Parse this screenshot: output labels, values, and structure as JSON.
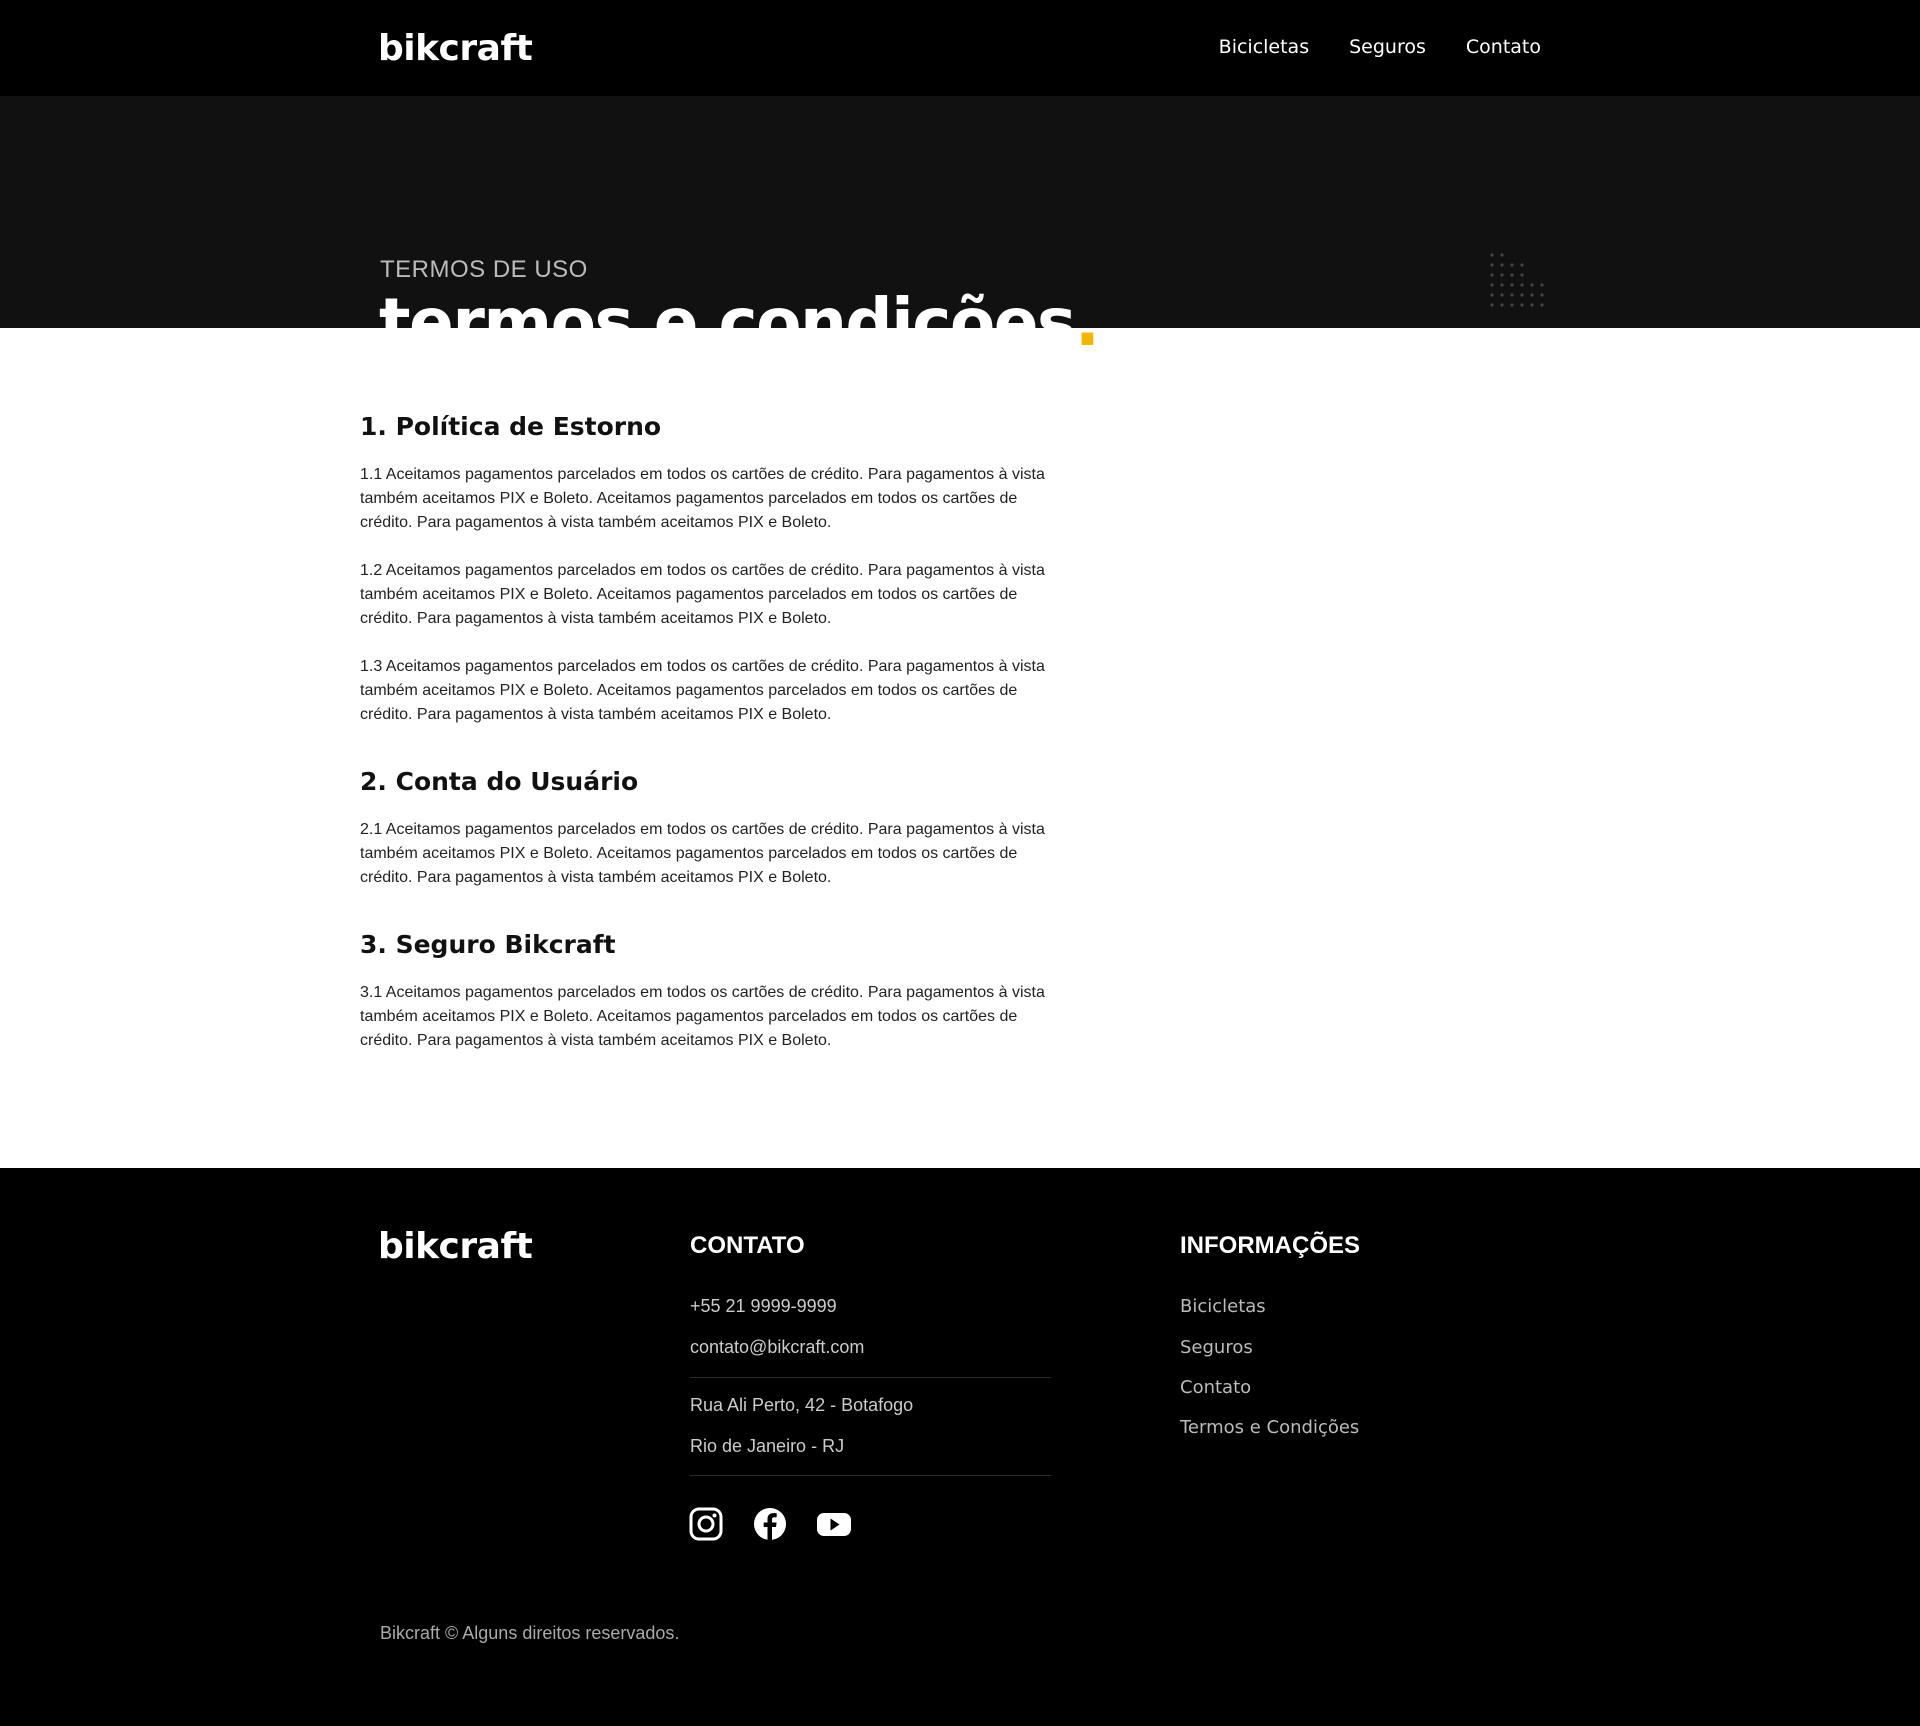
{
  "header": {
    "logo": "bikcraft",
    "nav": [
      "Bicicletas",
      "Seguros",
      "Contato"
    ]
  },
  "hero": {
    "subtitle": "TERMOS DE USO",
    "title": "termos e condições",
    "title_dot": ".",
    "accent_color": "#f2b705"
  },
  "sections": [
    {
      "title": "1. Política de Estorno",
      "paragraphs": [
        "1.1 Aceitamos pagamentos parcelados em todos os cartões de crédito. Para pagamentos à vista também aceitamos PIX e Boleto. Aceitamos pagamentos parcelados em todos os cartões de crédito. Para pagamentos à vista também aceitamos PIX e Boleto.",
        "1.2 Aceitamos pagamentos parcelados em todos os cartões de crédito. Para pagamentos à vista também aceitamos PIX e Boleto. Aceitamos pagamentos parcelados em todos os cartões de crédito. Para pagamentos à vista também aceitamos PIX e Boleto.",
        "1.3 Aceitamos pagamentos parcelados em todos os cartões de crédito. Para pagamentos à vista também aceitamos PIX e Boleto. Aceitamos pagamentos parcelados em todos os cartões de crédito. Para pagamentos à vista também aceitamos PIX e Boleto."
      ]
    },
    {
      "title": "2. Conta do Usuário",
      "paragraphs": [
        "2.1 Aceitamos pagamentos parcelados em todos os cartões de crédito. Para pagamentos à vista também aceitamos PIX e Boleto. Aceitamos pagamentos parcelados em todos os cartões de crédito. Para pagamentos à vista também aceitamos PIX e Boleto."
      ]
    },
    {
      "title": "3. Seguro Bikcraft",
      "paragraphs": [
        "3.1 Aceitamos pagamentos parcelados em todos os cartões de crédito. Para pagamentos à vista também aceitamos PIX e Boleto. Aceitamos pagamentos parcelados em todos os cartões de crédito. Para pagamentos à vista também aceitamos PIX e Boleto."
      ]
    }
  ],
  "footer": {
    "logo": "bikcraft",
    "contact_title": "CONTATO",
    "phone": "+55 21 9999-9999",
    "email": "contato@bikcraft.com",
    "address_line1": "Rua Ali Perto, 42 - Botafogo",
    "address_line2": "Rio de Janeiro - RJ",
    "social_icons": [
      "instagram-icon",
      "facebook-icon",
      "youtube-icon"
    ],
    "info_title": "INFORMAÇÕES",
    "info_links": [
      "Bicicletas",
      "Seguros",
      "Contato",
      "Termos e Condições"
    ],
    "copyright": "Bikcraft © Alguns direitos reservados."
  }
}
